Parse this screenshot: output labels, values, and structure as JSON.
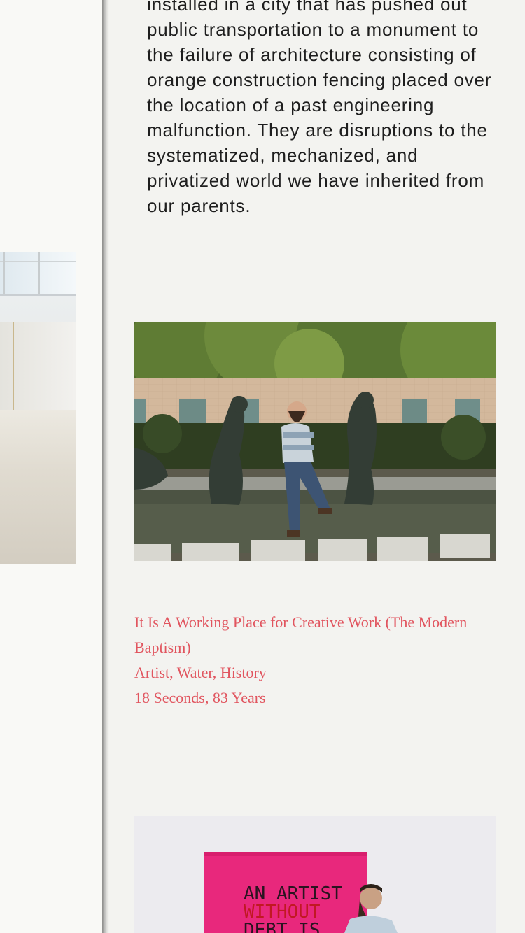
{
  "intro": {
    "text": "installed in a city that has pushed out public transportation to a monument to the failure of architecture consisting of orange construction fencing placed over the location of a past engineering malfunction. They are disruptions to the systematized, mechanized, and privatized world we have inherited from our parents."
  },
  "project": {
    "title": "It Is A Working Place for Creative Work (The Modern Baptism)",
    "tags": "Artist, Water, History",
    "duration": "18 Seconds, 83 Years"
  },
  "banner_photo": {
    "lines": [
      "AN ARTIST",
      "WITHOUT",
      "DEBT IS"
    ]
  },
  "colors": {
    "link": "#e1555f",
    "banner": "#e8287c",
    "background": "#f3f3f0"
  }
}
